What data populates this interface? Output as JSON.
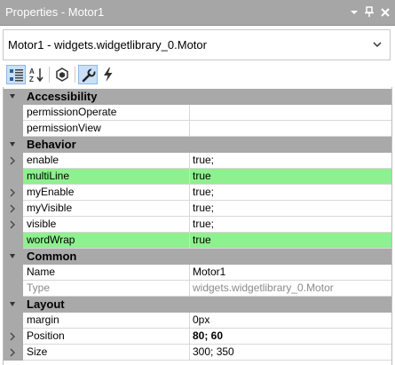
{
  "panel": {
    "title": "Properties - Motor1",
    "dropdown_icon": "dropdown-arrow-icon",
    "pin_icon": "pin-icon",
    "close_icon": "close-icon"
  },
  "selector": {
    "value": "Motor1 - widgets.widgetlibrary_0.Motor"
  },
  "toolbar": {
    "buttons": [
      {
        "icon": "categorized-icon",
        "active": true
      },
      {
        "icon": "alphabetical-sort-icon",
        "active": false
      },
      {
        "icon": "object-icon",
        "active": false
      },
      {
        "icon": "properties-wrench-icon",
        "active": true
      },
      {
        "icon": "events-lightning-icon",
        "active": false
      }
    ]
  },
  "colors": {
    "category_bg": "#a9a9a9",
    "highlight": "#8ef08e",
    "title_bg": "#a6a6a6",
    "toolbar_active": "#c9e0f7"
  },
  "grid": {
    "categories": [
      {
        "name": "Accessibility",
        "rows": [
          {
            "name": "permissionOperate",
            "value": ""
          },
          {
            "name": "permissionView",
            "value": ""
          }
        ]
      },
      {
        "name": "Behavior",
        "rows": [
          {
            "name": "enable",
            "value": "true;"
          },
          {
            "name": "multiLine",
            "value": "true"
          },
          {
            "name": "myEnable",
            "value": "true;"
          },
          {
            "name": "myVisible",
            "value": "true;"
          },
          {
            "name": "visible",
            "value": "true;"
          },
          {
            "name": "wordWrap",
            "value": "true"
          }
        ]
      },
      {
        "name": "Common",
        "rows": [
          {
            "name": "Name",
            "value": "Motor1"
          },
          {
            "name": "Type",
            "value": "widgets.widgetlibrary_0.Motor"
          }
        ]
      },
      {
        "name": "Layout",
        "rows": [
          {
            "name": "margin",
            "value": "0px"
          },
          {
            "name": "Position",
            "value": "80; 60"
          },
          {
            "name": "Size",
            "value": "300; 350"
          }
        ]
      }
    ]
  }
}
